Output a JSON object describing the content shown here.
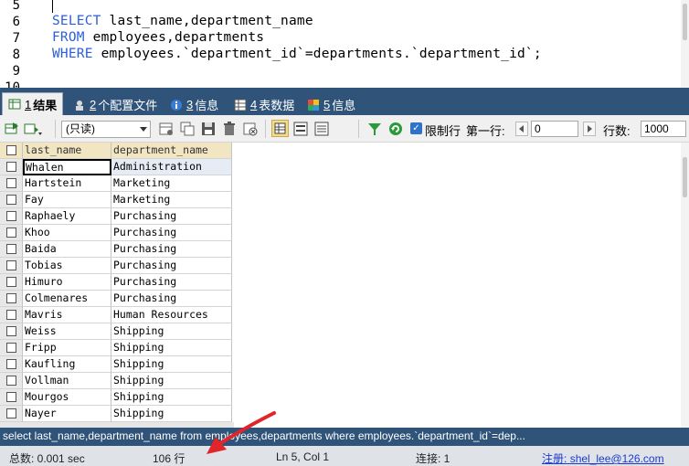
{
  "editor": {
    "line_numbers": [
      "5",
      "6",
      "7",
      "8",
      "9",
      "10"
    ],
    "lines": [
      {
        "kw": "SELECT",
        "rest": " last_name,department_name"
      },
      {
        "kw": "FROM",
        "rest": " employees,departments"
      },
      {
        "kw": "WHERE",
        "rest": " employees.`department_id`=departments.`department_id`;"
      }
    ]
  },
  "tabs": [
    {
      "num": "1",
      "label": "结果",
      "icon": "result-grid-icon",
      "active": true
    },
    {
      "num": "2",
      "label": "个配置文件",
      "icon": "profile-icon",
      "active": false
    },
    {
      "num": "3",
      "label": "信息",
      "icon": "info-icon",
      "active": false
    },
    {
      "num": "4",
      "label": "表数据",
      "icon": "table-data-icon",
      "active": false
    },
    {
      "num": "5",
      "label": "信息",
      "icon": "info-blocks-icon",
      "active": false
    }
  ],
  "toolbar": {
    "mode_select": "(只读)",
    "limit_label": "限制行",
    "first_row_label": "第一行:",
    "first_row_value": "0",
    "rows_label": "行数:",
    "rows_value": "1000"
  },
  "grid": {
    "columns": [
      "last_name",
      "department_name"
    ],
    "rows": [
      [
        "Whalen",
        "Administration"
      ],
      [
        "Hartstein",
        "Marketing"
      ],
      [
        "Fay",
        "Marketing"
      ],
      [
        "Raphaely",
        "Purchasing"
      ],
      [
        "Khoo",
        "Purchasing"
      ],
      [
        "Baida",
        "Purchasing"
      ],
      [
        "Tobias",
        "Purchasing"
      ],
      [
        "Himuro",
        "Purchasing"
      ],
      [
        "Colmenares",
        "Purchasing"
      ],
      [
        "Mavris",
        "Human Resources"
      ],
      [
        "Weiss",
        "Shipping"
      ],
      [
        "Fripp",
        "Shipping"
      ],
      [
        "Kaufling",
        "Shipping"
      ],
      [
        "Vollman",
        "Shipping"
      ],
      [
        "Mourgos",
        "Shipping"
      ],
      [
        "Nayer",
        "Shipping"
      ]
    ]
  },
  "sql_echo": "select last_name,department_name from employees,departments where employees.`department_id`=dep...",
  "status": {
    "total_time": "总数: 0.001 sec",
    "row_count": "106 行",
    "cursor_pos": "Ln 5, Col 1",
    "connections": "连接: 1",
    "register_label": "注册:",
    "register_user": "shel_lee@126.com"
  },
  "colors": {
    "tab_bar": "#2f5379",
    "header_cell": "#f2e6c2",
    "keyword": "#2b5fd6",
    "annotation_arrow": "#e0262a"
  }
}
